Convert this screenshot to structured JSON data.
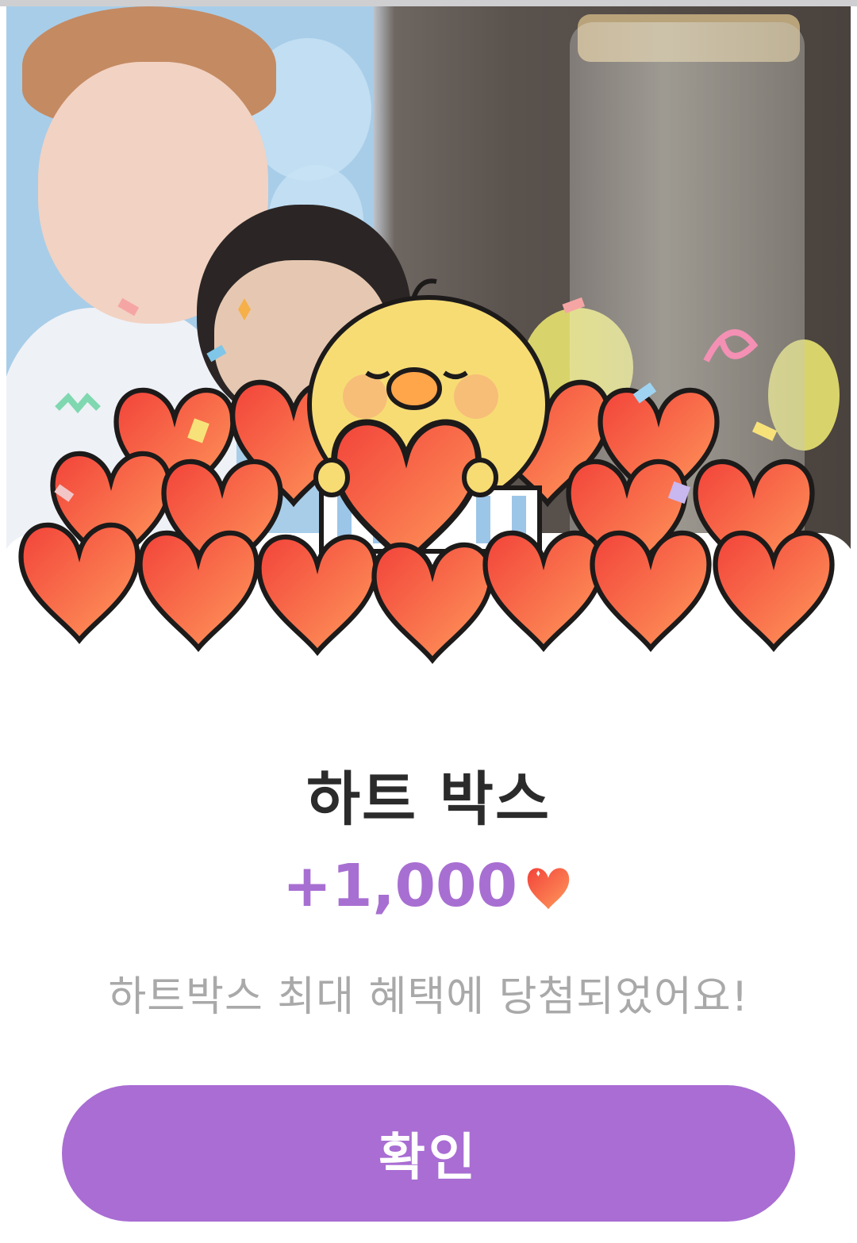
{
  "dialog": {
    "title": "하트 박스",
    "reward_amount": "+1,000",
    "reward_icon": "heart-icon",
    "message": "하트박스 최대 혜택에 당첨되었어요!",
    "confirm_label": "확인"
  },
  "colors": {
    "accent": "#a96dd3",
    "reward_text": "#a86fd2",
    "title_text": "#2b2b2b",
    "message_text": "#a9a9a9",
    "heart_light": "#ff9a5c",
    "heart_dark": "#f2433a"
  }
}
